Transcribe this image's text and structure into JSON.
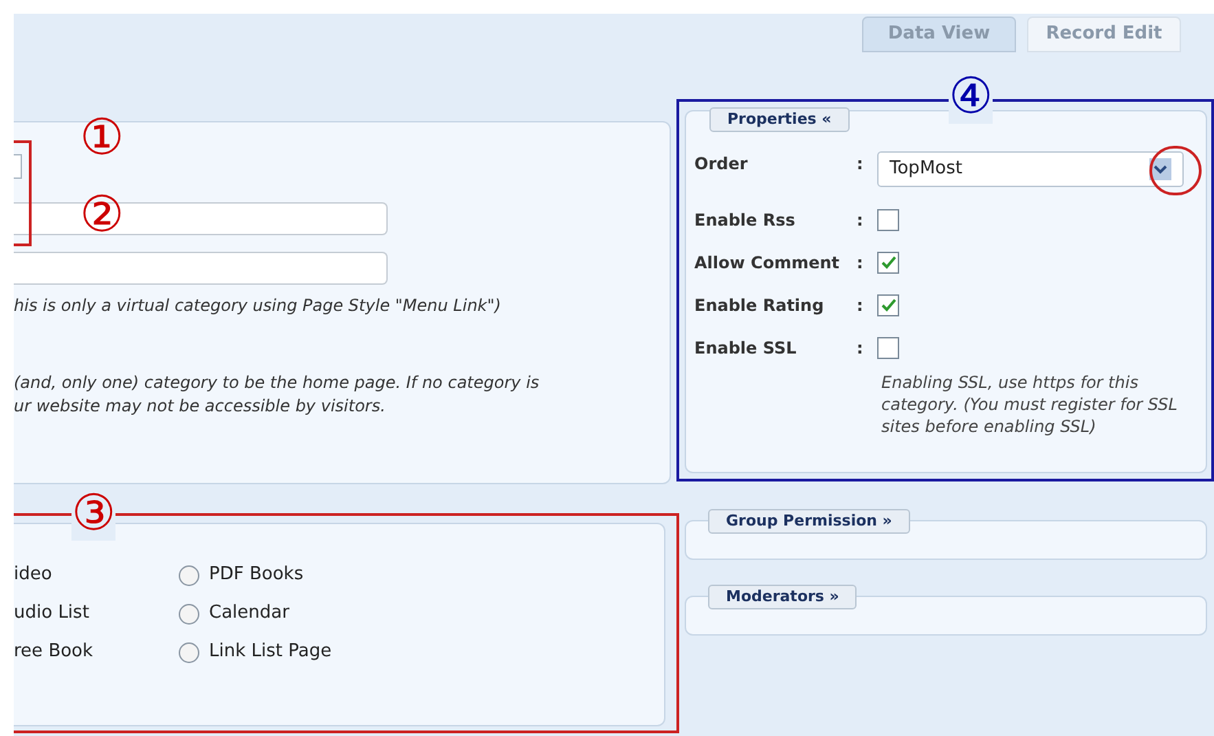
{
  "tabs": [
    {
      "label": "Data View",
      "selected": true
    },
    {
      "label": "Record Edit",
      "selected": false
    }
  ],
  "general": {
    "notes": [
      {
        "lines": [
          "his is only a virtual category using Page Style \"Menu Link\")"
        ]
      },
      {
        "lines": [
          "(and, only one) category to be the home page. If no category is",
          "ur website may not be accessible by visitors."
        ]
      }
    ]
  },
  "page_styles": {
    "columns": [
      {
        "options": [
          {
            "label": "ideo"
          },
          {
            "label": "udio List"
          },
          {
            "label": "ree Book"
          }
        ]
      },
      {
        "options": [
          {
            "label": "PDF Books",
            "selected": false
          },
          {
            "label": "Calendar",
            "selected": false
          },
          {
            "label": "Link List Page",
            "selected": false
          }
        ]
      }
    ]
  },
  "properties": {
    "title": "Properties «",
    "rows": [
      {
        "kind": "select",
        "label": "Order",
        "separator": ":",
        "value": "TopMost"
      },
      {
        "kind": "checkbox",
        "label": "Enable Rss",
        "separator": ":",
        "checked": false
      },
      {
        "kind": "checkbox",
        "label": "Allow Comment",
        "separator": ":",
        "checked": true
      },
      {
        "kind": "checkbox",
        "label": "Enable Rating",
        "separator": ":",
        "checked": true
      },
      {
        "kind": "checkbox",
        "label": "Enable SSL",
        "separator": ":",
        "checked": false
      }
    ],
    "note": "Enabling SSL, use https for this category. (You must register for SSL sites before enabling SSL)"
  },
  "collapsed_sections": [
    {
      "title": "Group Permission »"
    },
    {
      "title": "Moderators »"
    }
  ],
  "callouts": [
    {
      "label": "①",
      "color": "#cc0000"
    },
    {
      "label": "②",
      "color": "#cc0000"
    },
    {
      "label": "③",
      "color": "#cc0000"
    },
    {
      "label": "④",
      "color": "#0000aa"
    }
  ]
}
